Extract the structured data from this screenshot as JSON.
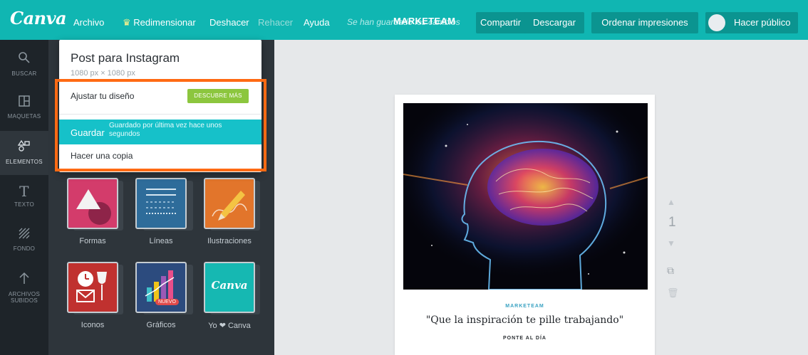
{
  "topbar": {
    "logo": "Canva",
    "menu": {
      "archivo": "Archivo",
      "redimensionar": "Redimensionar",
      "deshacer": "Deshacer",
      "rehacer": "Rehacer",
      "ayuda": "Ayuda"
    },
    "saved_message": "Se han guardado los cambios",
    "project_title": "MARKETEAM",
    "buttons": {
      "share": "Compartir",
      "download": "Descargar",
      "order_prints": "Ordenar impresiones",
      "make_public": "Hacer público"
    },
    "accent_color": "#10b6b2"
  },
  "rail": {
    "items": [
      {
        "label": "BUSCAR",
        "icon": "search-icon"
      },
      {
        "label": "MAQUETAS",
        "icon": "layouts-icon"
      },
      {
        "label": "ELEMENTOS",
        "icon": "elements-icon"
      },
      {
        "label": "TEXTO",
        "icon": "text-icon"
      },
      {
        "label": "FONDO",
        "icon": "background-icon"
      },
      {
        "label": "ARCHIVOS",
        "label2": "SUBIDOS",
        "icon": "upload-icon"
      }
    ],
    "active_index": 2
  },
  "panel": {
    "tiles": [
      {
        "label": "Formas"
      },
      {
        "label": "Líneas"
      },
      {
        "label": "Ilustraciones"
      },
      {
        "label": "Iconos"
      },
      {
        "label": "Gráficos",
        "badge": "NUEVO"
      },
      {
        "label": "Yo ❤ Canva",
        "logo": "Canva"
      }
    ]
  },
  "dropdown": {
    "title": "Post para Instagram",
    "size": "1080 px × 1080 px",
    "resize_label": "Ajustar tu diseño",
    "discover_button": "DESCUBRE MÁS",
    "save_label": "Guardar",
    "save_note": "Guardado por última vez hace unos segundos",
    "copy_label": "Hacer una copia",
    "highlight_color": "#ff6a13"
  },
  "canvas": {
    "brand": "MARKETEAM",
    "quote": "\"Que la inspiración te pille trabajando\"",
    "tagline": "PONTE AL DÍA",
    "page_number": "1"
  }
}
